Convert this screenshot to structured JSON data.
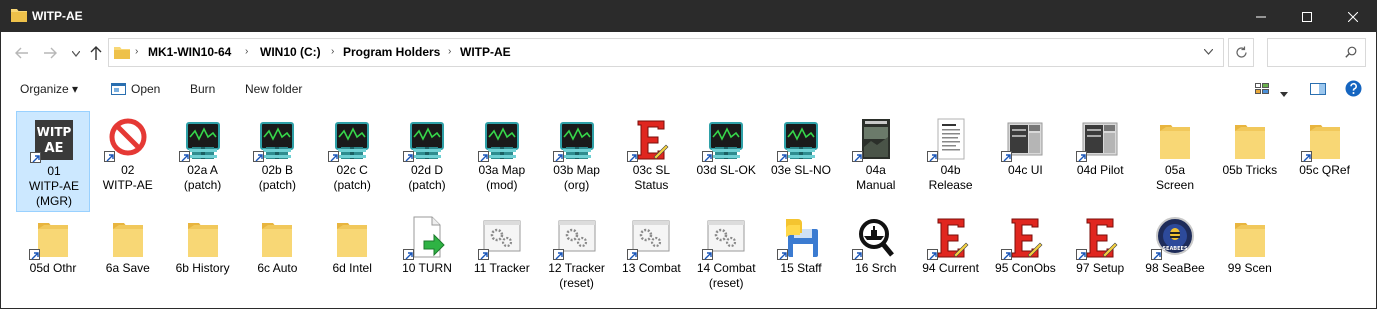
{
  "window": {
    "title": "WITP-AE",
    "minimize_label": "—",
    "maximize_label": "☐",
    "close_label": "✕"
  },
  "address": {
    "crumbs": [
      "MK1-WIN10-64",
      "WIN10 (C:)",
      "Program Holders",
      "WITP-AE"
    ],
    "separator": "›"
  },
  "toolbar": {
    "organize_label": "Organize ▾",
    "open_label": "Open",
    "burn_label": "Burn",
    "new_folder_label": "New folder"
  },
  "colors": {
    "titlebar": "#2b2b2b",
    "selection_bg": "#cce8ff",
    "selection_border": "#99d1ff",
    "folder": "#f8d775",
    "help": "#1565c0"
  },
  "items_row1": [
    {
      "label": "01\nWITP-AE\n(MGR)",
      "icon": "witp-game-icon",
      "selected": true
    },
    {
      "label": "02\nWITP-AE",
      "icon": "no-entry-icon"
    },
    {
      "label": "02a A\n(patch)",
      "icon": "zip-archive-icon"
    },
    {
      "label": "02b B\n(patch)",
      "icon": "zip-archive-icon"
    },
    {
      "label": "02c C\n(patch)",
      "icon": "zip-archive-icon"
    },
    {
      "label": "02d D\n(patch)",
      "icon": "zip-archive-icon"
    },
    {
      "label": "03a Map\n(mod)",
      "icon": "zip-archive-icon"
    },
    {
      "label": "03b Map\n(org)",
      "icon": "zip-archive-icon"
    },
    {
      "label": "03c SL\nStatus",
      "icon": "editor-e-icon"
    },
    {
      "label": "03d SL-OK",
      "icon": "zip-archive-icon"
    },
    {
      "label": "03e SL-NO",
      "icon": "zip-archive-icon"
    },
    {
      "label": "04a\nManual",
      "icon": "manual-cover-icon"
    },
    {
      "label": "04b\nRelease",
      "icon": "document-icon"
    },
    {
      "label": "04c UI",
      "icon": "screenshot-icon"
    },
    {
      "label": "04d Pilot",
      "icon": "screenshot-icon"
    },
    {
      "label": "05a\nScreen",
      "icon": "folder-icon"
    },
    {
      "label": "05b Tricks",
      "icon": "folder-icon"
    },
    {
      "label": "05c QRef",
      "icon": "folder-icon"
    }
  ],
  "items_row2": [
    {
      "label": "05d Othr",
      "icon": "folder-icon"
    },
    {
      "label": "6a Save",
      "icon": "folder-icon"
    },
    {
      "label": "6b History",
      "icon": "folder-icon"
    },
    {
      "label": "6c Auto",
      "icon": "folder-icon"
    },
    {
      "label": "6d Intel",
      "icon": "folder-icon"
    },
    {
      "label": "10 TURN",
      "icon": "file-arrow-icon"
    },
    {
      "label": "11 Tracker",
      "icon": "app-window-icon"
    },
    {
      "label": "12 Tracker\n(reset)",
      "icon": "app-window-icon"
    },
    {
      "label": "13 Combat",
      "icon": "app-window-icon"
    },
    {
      "label": "14 Combat\n(reset)",
      "icon": "app-window-icon"
    },
    {
      "label": "15 Staff",
      "icon": "python-floppy-icon"
    },
    {
      "label": "16 Srch",
      "icon": "magnifier-ship-icon"
    },
    {
      "label": "94 Current",
      "icon": "editor-e-icon"
    },
    {
      "label": "95 ConObs",
      "icon": "editor-e-icon"
    },
    {
      "label": "97 Setup",
      "icon": "editor-e-icon"
    },
    {
      "label": "98 SeaBee",
      "icon": "seabees-badge-icon"
    },
    {
      "label": "99 Scen",
      "icon": "folder-icon"
    }
  ],
  "seabees_text": "SEABEES"
}
